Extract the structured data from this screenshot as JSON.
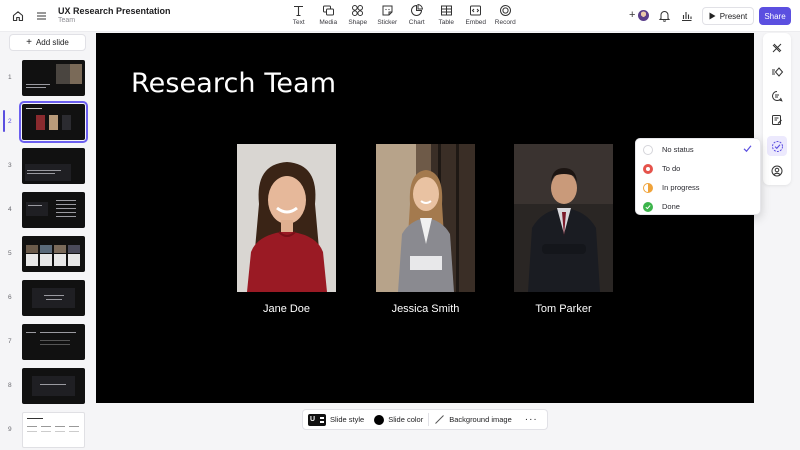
{
  "app": {
    "title": "UX Research Presentation",
    "subtitle": "Team"
  },
  "toolbar": {
    "tools": [
      {
        "label": "Text",
        "icon": "text-icon"
      },
      {
        "label": "Media",
        "icon": "media-icon"
      },
      {
        "label": "Shape",
        "icon": "shape-icon"
      },
      {
        "label": "Sticker",
        "icon": "sticker-icon"
      },
      {
        "label": "Chart",
        "icon": "chart-icon"
      },
      {
        "label": "Table",
        "icon": "table-icon"
      },
      {
        "label": "Embed",
        "icon": "embed-icon"
      },
      {
        "label": "Record",
        "icon": "record-icon"
      }
    ],
    "present_label": "Present",
    "share_label": "Share",
    "add_collaborator": "+"
  },
  "sidebar": {
    "add_slide_label": "Add slide",
    "slides": [
      {
        "number": "1"
      },
      {
        "number": "2",
        "active": true
      },
      {
        "number": "3"
      },
      {
        "number": "4"
      },
      {
        "number": "5"
      },
      {
        "number": "6"
      },
      {
        "number": "7"
      },
      {
        "number": "8"
      },
      {
        "number": "9"
      }
    ]
  },
  "slide": {
    "title": "Research Team",
    "members": [
      {
        "name": "Jane Doe"
      },
      {
        "name": "Jessica Smith"
      },
      {
        "name": "Tom Parker"
      }
    ]
  },
  "status_menu": {
    "items": [
      {
        "label": "No status",
        "color": "#ffffff",
        "selected": true
      },
      {
        "label": "To do",
        "color": "#e5534b"
      },
      {
        "label": "In progress",
        "color": "#f0a33a"
      },
      {
        "label": "Done",
        "color": "#3cb44b"
      }
    ]
  },
  "bottom_bar": {
    "style_badge": "U",
    "slide_style_label": "Slide style",
    "slide_color_label": "Slide color",
    "background_image_label": "Background image",
    "more_label": "···"
  },
  "colors": {
    "accent": "#5b4fe0",
    "slide_background": "#000000"
  }
}
